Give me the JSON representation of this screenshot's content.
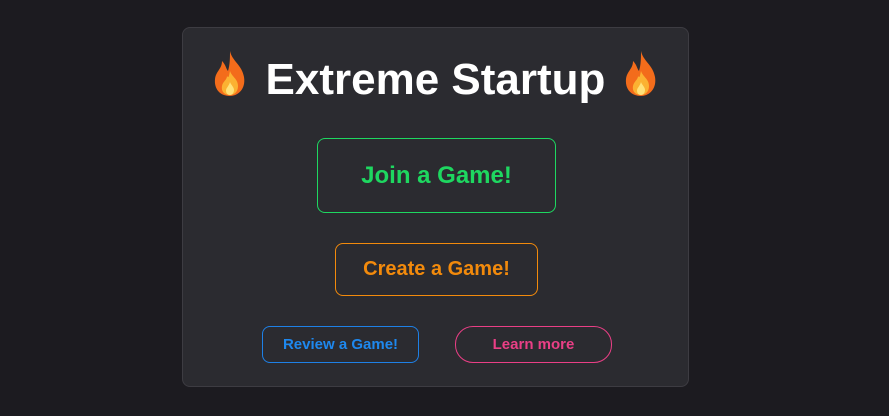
{
  "header": {
    "title": "Extreme Startup",
    "left_icon": "flame-icon",
    "right_icon": "flame-icon"
  },
  "actions": {
    "join_label": "Join a Game!",
    "create_label": "Create a Game!",
    "review_label": "Review a Game!",
    "learn_label": "Learn more"
  },
  "colors": {
    "background": "#1c1b20",
    "card": "#2b2b30",
    "join": "#1ed760",
    "create": "#f28a0c",
    "review": "#1e88ee",
    "learn": "#ea3f86"
  }
}
